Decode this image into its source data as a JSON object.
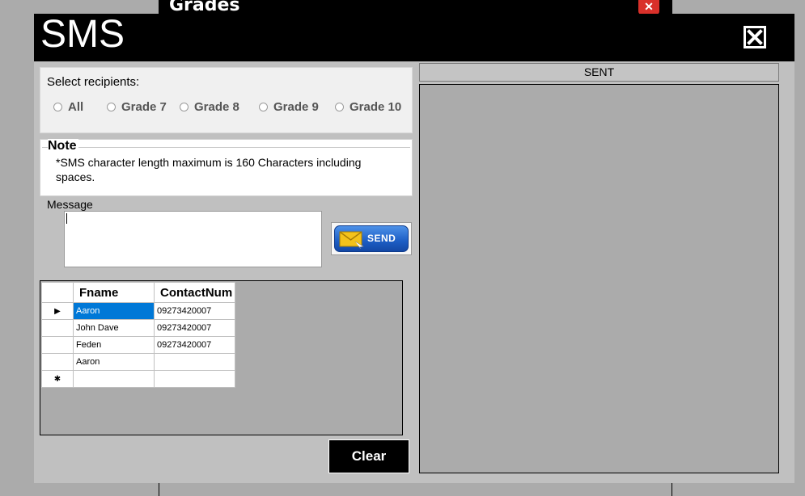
{
  "background_window": {
    "title": "Grades",
    "close_glyph": "✕",
    "close_icon": "close-icon",
    "close_color": "#d9302a"
  },
  "window": {
    "title": "SMS",
    "close_icon": "close-icon"
  },
  "recipients": {
    "label": "Select recipients:",
    "options": [
      "All",
      "Grade 7",
      "Grade 8",
      "Grade 9",
      "Grade 10"
    ]
  },
  "note": {
    "title": "Note",
    "text": "*SMS character length maximum is 160 Characters including spaces."
  },
  "message": {
    "label": "Message",
    "value": ""
  },
  "send_button": {
    "label": "SEND",
    "icon": "envelope-icon",
    "accent": "#1c5dc4"
  },
  "grid": {
    "columns": [
      "Fname",
      "ContactNum"
    ],
    "rows": [
      {
        "fname": "Aaron",
        "contact": "09273420007",
        "current": true
      },
      {
        "fname": "John Dave",
        "contact": "09273420007"
      },
      {
        "fname": "Feden",
        "contact": "09273420007"
      },
      {
        "fname": "Aaron",
        "contact": ""
      }
    ],
    "current_row_marker": "▶",
    "new_row_marker": "✱",
    "selection_color": "#0078d7"
  },
  "clear_button": {
    "label": "Clear"
  },
  "sent_panel": {
    "header": "SENT"
  }
}
